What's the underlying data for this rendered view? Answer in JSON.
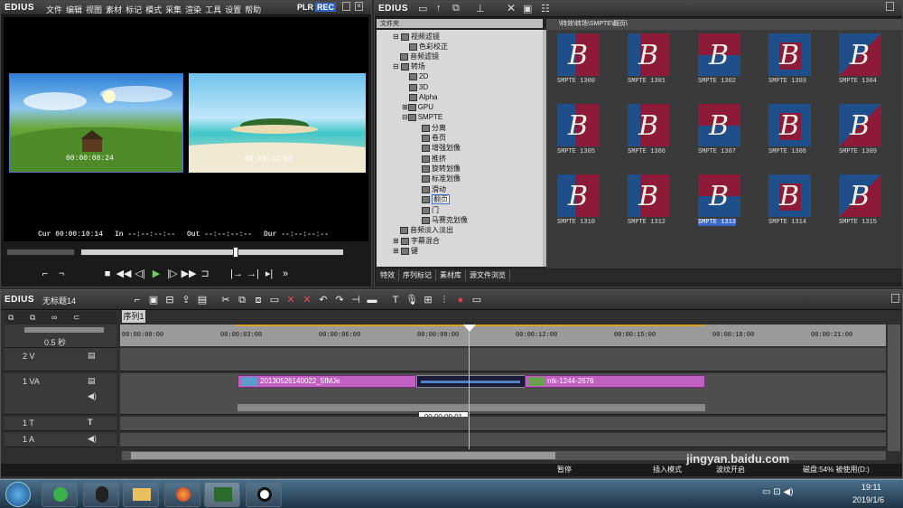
{
  "preview": {
    "logo": "EDIUS",
    "menu": [
      "文件",
      "编辑",
      "视图",
      "素材",
      "标记",
      "模式",
      "采集",
      "渲染",
      "工具",
      "设置",
      "帮助"
    ],
    "plr": "PLR",
    "rec": "REC",
    "left_frame_tc": "00:00:08:24",
    "right_frame_tc": "00:00:12:03",
    "tc_row": {
      "cur_label": "Cur",
      "cur": "00:00:10:14",
      "in_label": "In",
      "in": "--:--:--:--",
      "out_label": "Out",
      "out": "--:--:--:--",
      "dur_label": "Dur",
      "dur": "--:--:--:--"
    }
  },
  "bin": {
    "logo": "EDIUS",
    "tree_header": "文件夹",
    "path": "\\特效\\转场\\SMPTE\\翻页\\",
    "tree": [
      {
        "label": "视频滤镜"
      },
      {
        "label": "色彩校正"
      },
      {
        "label": "音频滤镜"
      },
      {
        "label": "转场"
      },
      {
        "label": "2D"
      },
      {
        "label": "3D"
      },
      {
        "label": "Alpha"
      },
      {
        "label": "GPU"
      },
      {
        "label": "SMPTE"
      },
      {
        "label": "分离"
      },
      {
        "label": "卷页"
      },
      {
        "label": "增强划像"
      },
      {
        "label": "推挤"
      },
      {
        "label": "旋转划像"
      },
      {
        "label": "标准划像"
      },
      {
        "label": "滑动"
      },
      {
        "label": "翻页"
      },
      {
        "label": "门"
      },
      {
        "label": "马赛克划像"
      },
      {
        "label": "音频淡入淡出"
      },
      {
        "label": "字幕混合"
      },
      {
        "label": "键"
      }
    ],
    "thumbs": [
      {
        "label": "SMPTE 1300"
      },
      {
        "label": "SMPTE 1301"
      },
      {
        "label": "SMPTE 1302"
      },
      {
        "label": "SMPTE 1303"
      },
      {
        "label": "SMPTE 1304"
      },
      {
        "label": "SMPTE 1305"
      },
      {
        "label": "SMPTE 1306"
      },
      {
        "label": "SMPTE 1307"
      },
      {
        "label": "SMPTE 1308"
      },
      {
        "label": "SMPTE 1309"
      },
      {
        "label": "SMPTE 1310"
      },
      {
        "label": "SMPTE 1312"
      },
      {
        "label": "SMPTE 1313"
      },
      {
        "label": "SMPTE 1314"
      },
      {
        "label": "SMPTE 1315"
      }
    ],
    "tabs": [
      "特效",
      "序列标记",
      "素材库",
      "源文件浏览"
    ],
    "colors": {
      "thumb_red": "#8e1a3a",
      "thumb_blue": "#1f4f8a",
      "selection": "#3a68c8"
    }
  },
  "timeline": {
    "logo": "EDIUS",
    "project": "无标题14",
    "sequence_tab": "序列1",
    "scale": "0.5 秒",
    "ruler": [
      "00:00:00:00",
      "00:00:03:00",
      "00:00:06:00",
      "00:00:09:00",
      "00:00:12:00",
      "00:00:15:00",
      "00:00:18:00",
      "00:00:21:00"
    ],
    "tracks": [
      {
        "name": "2 V"
      },
      {
        "name": "1 VA"
      },
      {
        "name": "1 T"
      },
      {
        "name": "1 A"
      }
    ],
    "clip1": "20130526140022_5fMJe",
    "clip2": "ntk-1244-2676",
    "tooltip": "00:00:09:01",
    "status": {
      "pause": "暂停",
      "insert": "插入模式",
      "ripple": "波纹开启",
      "disk": "磁盘:54% 被使用(D:)"
    }
  },
  "taskbar": {
    "time": "19:11",
    "date": "2019/1/6"
  },
  "watermark": "jingyan.baidu.com"
}
